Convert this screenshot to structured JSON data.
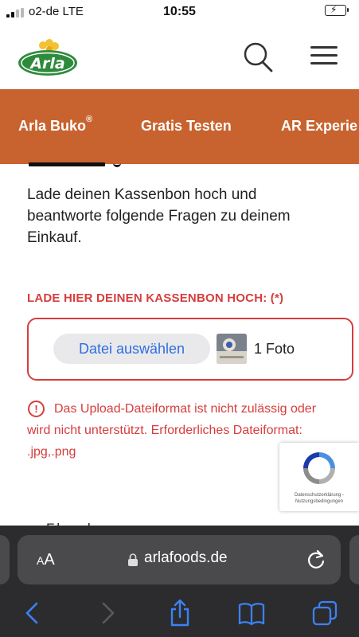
{
  "status_bar": {
    "carrier": "o2-de  LTE",
    "time": "10:55"
  },
  "header": {
    "logo_text": "Arla",
    "icons": [
      "arla-logo",
      "search-icon",
      "hamburger-menu-icon"
    ]
  },
  "nav": {
    "items": [
      {
        "label": "Arla Buko",
        "sup": "®"
      },
      {
        "label": "Gratis Testen"
      },
      {
        "label": "AR Experie"
      }
    ]
  },
  "content": {
    "intro": "Lade deinen Kassenbon hoch und beantworte folgende Fragen zu deinem Einkauf.",
    "upload_label": "LADE HIER DEINEN KASSENBON HOCH: (*)",
    "choose_button": "Datei auswählen",
    "file_count": "1 Foto",
    "error_message": "Das Upload-Dateiformat ist nicht zulässig oder wird nicht unterstützt. Erforderliches Dateiformat: .jpg,.png",
    "recaptcha_terms": "Datenschutzerklärung - Nutzungsbedingungen",
    "cut_text": "F.h..n.d"
  },
  "browser": {
    "aa": "AA",
    "url": "arlafoods.de"
  },
  "colors": {
    "brand_orange": "#c8632f",
    "error_red": "#d63d3d",
    "link_blue": "#2f6fe0",
    "arla_green": "#2e8b3c"
  }
}
